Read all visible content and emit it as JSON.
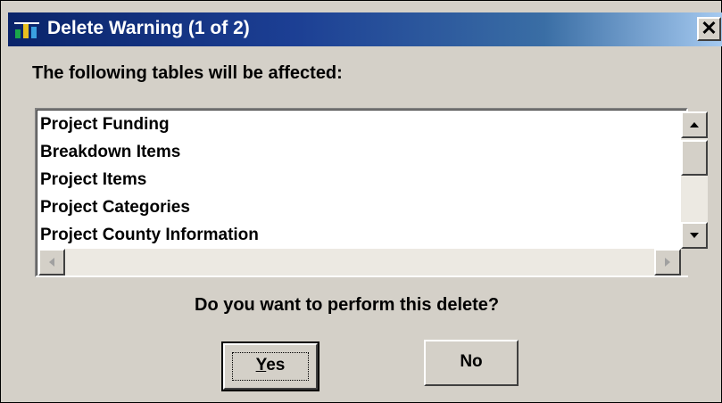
{
  "dialog": {
    "title": "Delete Warning (1 of 2)",
    "close_label": "✕",
    "prompt": "The following tables will be affected:",
    "tables": [
      "Project Funding",
      "Breakdown Items",
      "Project Items",
      "Project Categories",
      "Project County Information"
    ],
    "question": "Do you want to perform this delete?",
    "buttons": {
      "yes_accel": "Y",
      "yes_rest": "es",
      "no": "No"
    }
  },
  "colors": {
    "titlebar_start": "#0a246a",
    "titlebar_end": "#a6caf0",
    "face": "#d4d0c8"
  }
}
